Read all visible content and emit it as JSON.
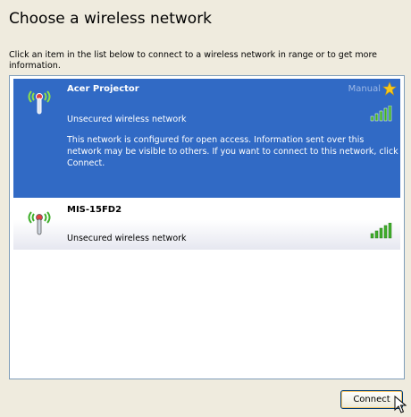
{
  "dialog": {
    "title": "Choose a wireless network",
    "instructions": "Click an item in the list below to connect to a wireless network in range or to get more information."
  },
  "networks": [
    {
      "name": "Acer Projector",
      "type": "Unsecured wireless network",
      "tag": "Manual",
      "description": "This network is configured for open access. Information sent over this network may be visible to others. If you want to connect to this network, click Connect.",
      "selected": true,
      "signal_strength": 5
    },
    {
      "name": "MIS-15FD2",
      "type": "Unsecured wireless network",
      "selected": false,
      "signal_strength": 5
    }
  ],
  "buttons": {
    "connect": "Connect"
  },
  "colors": {
    "selection": "#316ac5",
    "signal_green": "#3fae2a",
    "star": "#f8c81c"
  }
}
